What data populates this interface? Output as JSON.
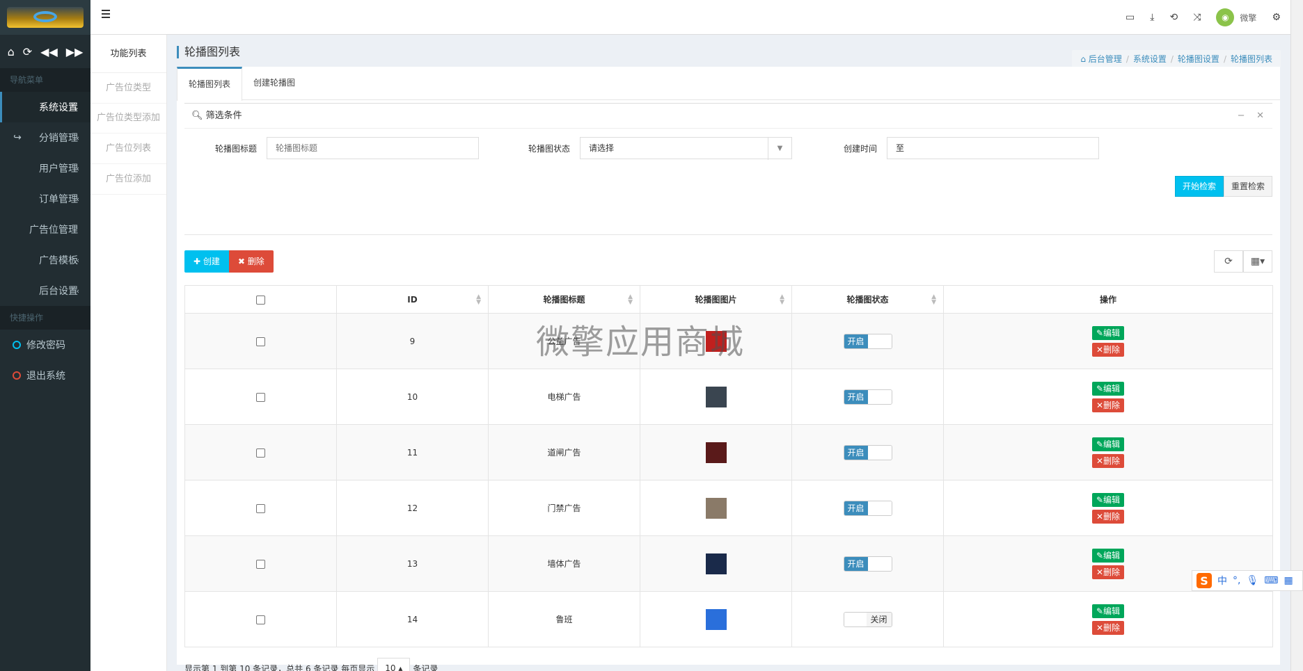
{
  "nav": {
    "section_nav": "导航菜单",
    "section_quick": "快捷操作",
    "items": [
      {
        "label": "系统设置",
        "chev": "⌄"
      },
      {
        "label": "分销管理",
        "chev": "‹"
      },
      {
        "label": "用户管理",
        "chev": "‹"
      },
      {
        "label": "订单管理",
        "chev": "‹"
      },
      {
        "label": "广告位管理",
        "chev": ""
      },
      {
        "label": "广告模板",
        "chev": "‹"
      },
      {
        "label": "后台设置",
        "chev": "‹"
      }
    ],
    "quick": [
      {
        "label": "修改密码",
        "color": "#00c0ef"
      },
      {
        "label": "退出系统",
        "color": "#dd4b39"
      }
    ]
  },
  "subnav": {
    "title": "功能列表",
    "items": [
      "广告位类型",
      "广告位类型添加",
      "广告位列表",
      "广告位添加"
    ]
  },
  "header": {
    "user_name": "微擎"
  },
  "page": {
    "title": "轮播图列表",
    "breadcrumb": [
      "后台管理",
      "系统设置",
      "轮播图设置",
      "轮播图列表"
    ],
    "tabs": [
      "轮播图列表",
      "创建轮播图"
    ]
  },
  "filter": {
    "title": "筛选条件",
    "title_label": "轮播图标题",
    "title_placeholder": "轮播图标题",
    "status_label": "轮播图状态",
    "status_value": "请选择",
    "time_label": "创建时间",
    "time_value": "至",
    "search_btn": "开始检索",
    "reset_btn": "重置检索"
  },
  "toolbar": {
    "create": "创建",
    "delete": "删除"
  },
  "table": {
    "headers": [
      "ID",
      "轮播图标题",
      "轮播图图片",
      "轮播图状态",
      "操作"
    ],
    "rows": [
      {
        "id": "9",
        "title": "公益广告",
        "status": "开启",
        "thumb": "#c0201e"
      },
      {
        "id": "10",
        "title": "电梯广告",
        "status": "开启",
        "thumb": "#3a4550"
      },
      {
        "id": "11",
        "title": "道闸广告",
        "status": "开启",
        "thumb": "#5a1a1a"
      },
      {
        "id": "12",
        "title": "门禁广告",
        "status": "开启",
        "thumb": "#8a7a68"
      },
      {
        "id": "13",
        "title": "墙体广告",
        "status": "开启",
        "thumb": "#1a2a4a"
      },
      {
        "id": "14",
        "title": "鲁班",
        "status": "关闭",
        "thumb": "#2a6fdb"
      }
    ],
    "edit_label": "编辑",
    "delete_label": "删除"
  },
  "pager": {
    "text_before": "显示第 1 到第 10 条记录，总共 6 条记录 每页显示",
    "page_size": "10",
    "text_after": "条记录"
  },
  "watermark": "微擎应用商城",
  "ime": {
    "label": "中"
  }
}
